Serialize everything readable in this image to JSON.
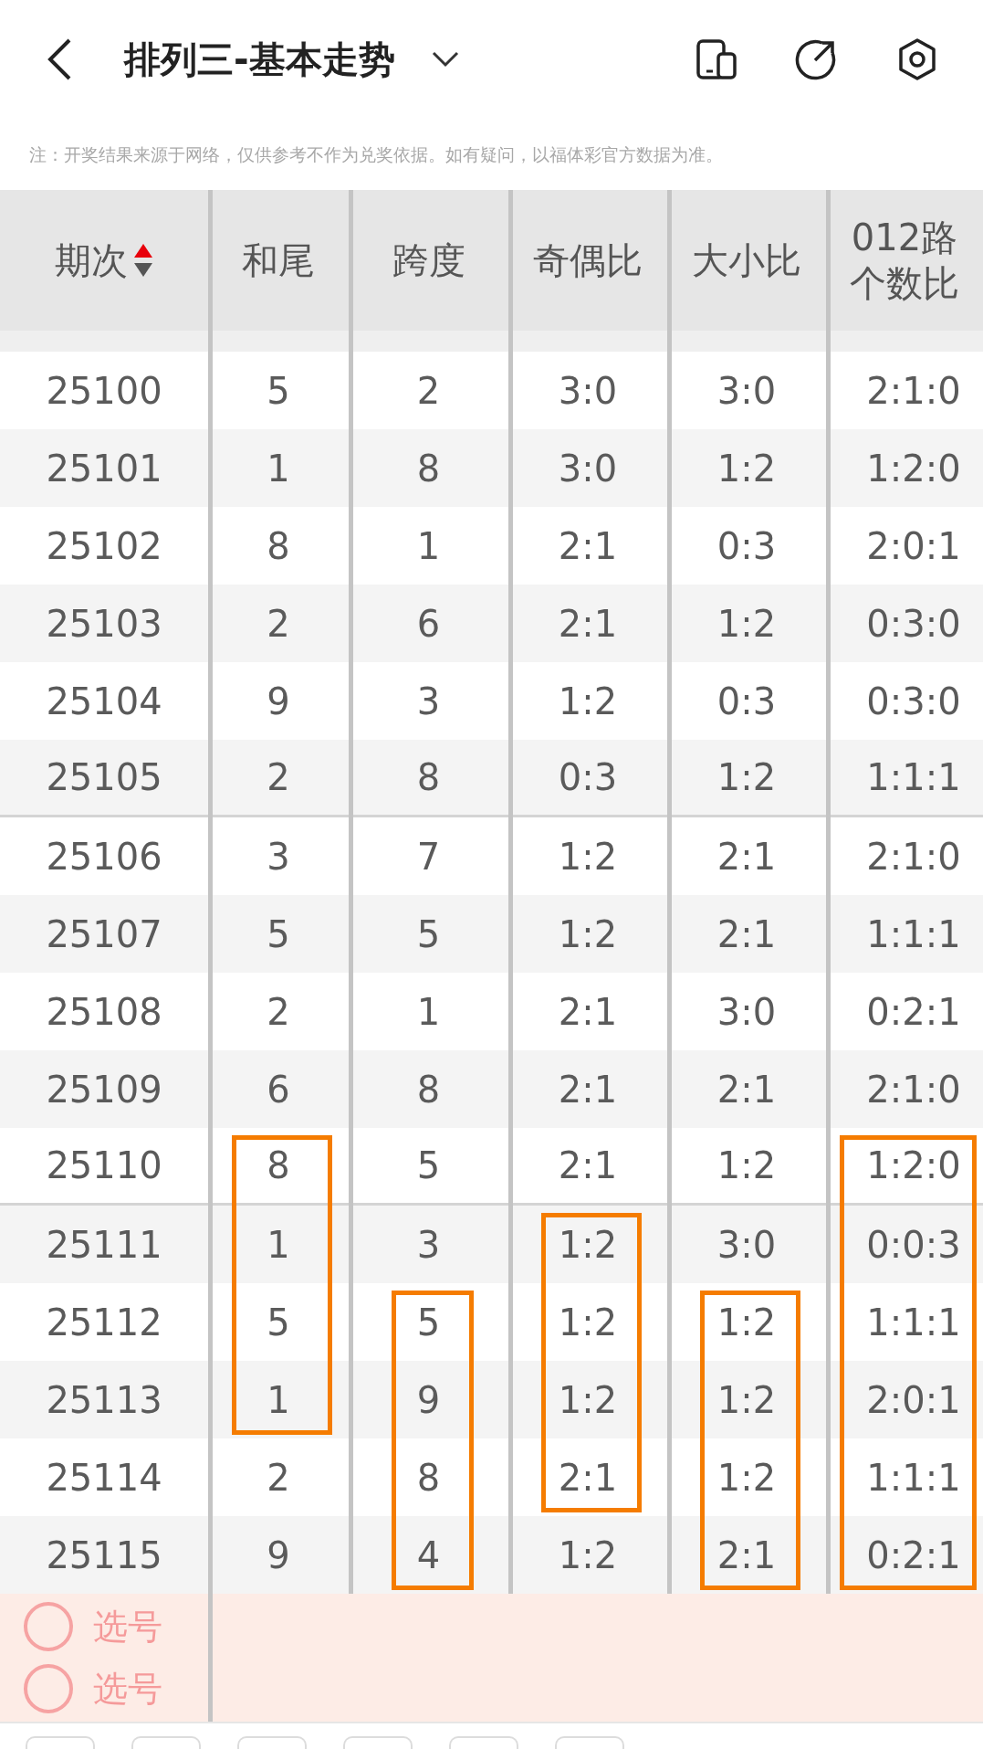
{
  "header": {
    "title": "排列三-基本走势"
  },
  "note": "注：开奖结果来源于网络，仅供参考不作为兑奖依据。如有疑问，以福体彩官方数据为准。",
  "table": {
    "columns": [
      "期次",
      "和尾",
      "跨度",
      "奇偶比",
      "大小比",
      "012路个数比"
    ],
    "rows": [
      {
        "group_end": false,
        "cells": [
          {
            "text": "25100",
            "boxed": false
          },
          {
            "text": "5",
            "boxed": false
          },
          {
            "text": "2",
            "boxed": false
          },
          {
            "text": "3:0",
            "boxed": false
          },
          {
            "text": "3:0",
            "boxed": false
          },
          {
            "text": "2:1:0",
            "boxed": false
          }
        ]
      },
      {
        "group_end": false,
        "cells": [
          {
            "text": "25101",
            "boxed": false
          },
          {
            "text": "1",
            "boxed": false
          },
          {
            "text": "8",
            "boxed": false
          },
          {
            "text": "3:0",
            "boxed": false
          },
          {
            "text": "1:2",
            "boxed": false
          },
          {
            "text": "1:2:0",
            "boxed": false
          }
        ]
      },
      {
        "group_end": false,
        "cells": [
          {
            "text": "25102",
            "boxed": false
          },
          {
            "text": "8",
            "boxed": false
          },
          {
            "text": "1",
            "boxed": false
          },
          {
            "text": "2:1",
            "boxed": false
          },
          {
            "text": "0:3",
            "boxed": false
          },
          {
            "text": "2:0:1",
            "boxed": false
          }
        ]
      },
      {
        "group_end": false,
        "cells": [
          {
            "text": "25103",
            "boxed": false
          },
          {
            "text": "2",
            "boxed": false
          },
          {
            "text": "6",
            "boxed": false
          },
          {
            "text": "2:1",
            "boxed": false
          },
          {
            "text": "1:2",
            "boxed": false
          },
          {
            "text": "0:3:0",
            "boxed": false
          }
        ]
      },
      {
        "group_end": false,
        "cells": [
          {
            "text": "25104",
            "boxed": false
          },
          {
            "text": "9",
            "boxed": false
          },
          {
            "text": "3",
            "boxed": false
          },
          {
            "text": "1:2",
            "boxed": false
          },
          {
            "text": "0:3",
            "boxed": false
          },
          {
            "text": "0:3:0",
            "boxed": false
          }
        ]
      },
      {
        "group_end": true,
        "cells": [
          {
            "text": "25105",
            "boxed": false
          },
          {
            "text": "2",
            "boxed": false
          },
          {
            "text": "8",
            "boxed": false
          },
          {
            "text": "0:3",
            "boxed": false
          },
          {
            "text": "1:2",
            "boxed": false
          },
          {
            "text": "1:1:1",
            "boxed": false
          }
        ]
      },
      {
        "group_end": false,
        "cells": [
          {
            "text": "25106",
            "boxed": false
          },
          {
            "text": "3",
            "boxed": false
          },
          {
            "text": "7",
            "boxed": false
          },
          {
            "text": "1:2",
            "boxed": false
          },
          {
            "text": "2:1",
            "boxed": false
          },
          {
            "text": "2:1:0",
            "boxed": false
          }
        ]
      },
      {
        "group_end": false,
        "cells": [
          {
            "text": "25107",
            "boxed": false
          },
          {
            "text": "5",
            "boxed": false
          },
          {
            "text": "5",
            "boxed": false
          },
          {
            "text": "1:2",
            "boxed": false
          },
          {
            "text": "2:1",
            "boxed": false
          },
          {
            "text": "1:1:1",
            "boxed": false
          }
        ]
      },
      {
        "group_end": false,
        "cells": [
          {
            "text": "25108",
            "boxed": false
          },
          {
            "text": "2",
            "boxed": false
          },
          {
            "text": "1",
            "boxed": false
          },
          {
            "text": "2:1",
            "boxed": false
          },
          {
            "text": "3:0",
            "boxed": false
          },
          {
            "text": "0:2:1",
            "boxed": false
          }
        ]
      },
      {
        "group_end": false,
        "cells": [
          {
            "text": "25109",
            "boxed": false
          },
          {
            "text": "6",
            "boxed": false
          },
          {
            "text": "8",
            "boxed": false
          },
          {
            "text": "2:1",
            "boxed": false
          },
          {
            "text": "2:1",
            "boxed": false
          },
          {
            "text": "2:1:0",
            "boxed": false
          }
        ]
      },
      {
        "group_end": true,
        "cells": [
          {
            "text": "25110",
            "boxed": false
          },
          {
            "text": "8",
            "boxed": true
          },
          {
            "text": "5",
            "boxed": false
          },
          {
            "text": "2:1",
            "boxed": false
          },
          {
            "text": "1:2",
            "boxed": false
          },
          {
            "text": "1:2:0",
            "boxed": true
          }
        ]
      },
      {
        "group_end": false,
        "cells": [
          {
            "text": "25111",
            "boxed": false
          },
          {
            "text": "1",
            "boxed": true
          },
          {
            "text": "3",
            "boxed": false
          },
          {
            "text": "1:2",
            "boxed": true
          },
          {
            "text": "3:0",
            "boxed": false
          },
          {
            "text": "0:0:3",
            "boxed": true
          }
        ]
      },
      {
        "group_end": false,
        "cells": [
          {
            "text": "25112",
            "boxed": false
          },
          {
            "text": "5",
            "boxed": true
          },
          {
            "text": "5",
            "boxed": true
          },
          {
            "text": "1:2",
            "boxed": true
          },
          {
            "text": "1:2",
            "boxed": true
          },
          {
            "text": "1:1:1",
            "boxed": true
          }
        ]
      },
      {
        "group_end": false,
        "cells": [
          {
            "text": "25113",
            "boxed": false
          },
          {
            "text": "1",
            "boxed": true
          },
          {
            "text": "9",
            "boxed": true
          },
          {
            "text": "1:2",
            "boxed": true
          },
          {
            "text": "1:2",
            "boxed": true
          },
          {
            "text": "2:0:1",
            "boxed": true
          }
        ]
      },
      {
        "group_end": false,
        "cells": [
          {
            "text": "25114",
            "boxed": false
          },
          {
            "text": "2",
            "boxed": false
          },
          {
            "text": "8",
            "boxed": true
          },
          {
            "text": "2:1",
            "boxed": true
          },
          {
            "text": "1:2",
            "boxed": true
          },
          {
            "text": "1:1:1",
            "boxed": true
          }
        ]
      },
      {
        "group_end": false,
        "cells": [
          {
            "text": "25115",
            "boxed": false
          },
          {
            "text": "9",
            "boxed": false
          },
          {
            "text": "4",
            "boxed": true
          },
          {
            "text": "1:2",
            "boxed": false
          },
          {
            "text": "2:1",
            "boxed": true
          },
          {
            "text": "0:2:1",
            "boxed": true
          }
        ]
      }
    ]
  },
  "pick_rows": [
    {
      "label": "选号"
    },
    {
      "label": "选号"
    }
  ]
}
